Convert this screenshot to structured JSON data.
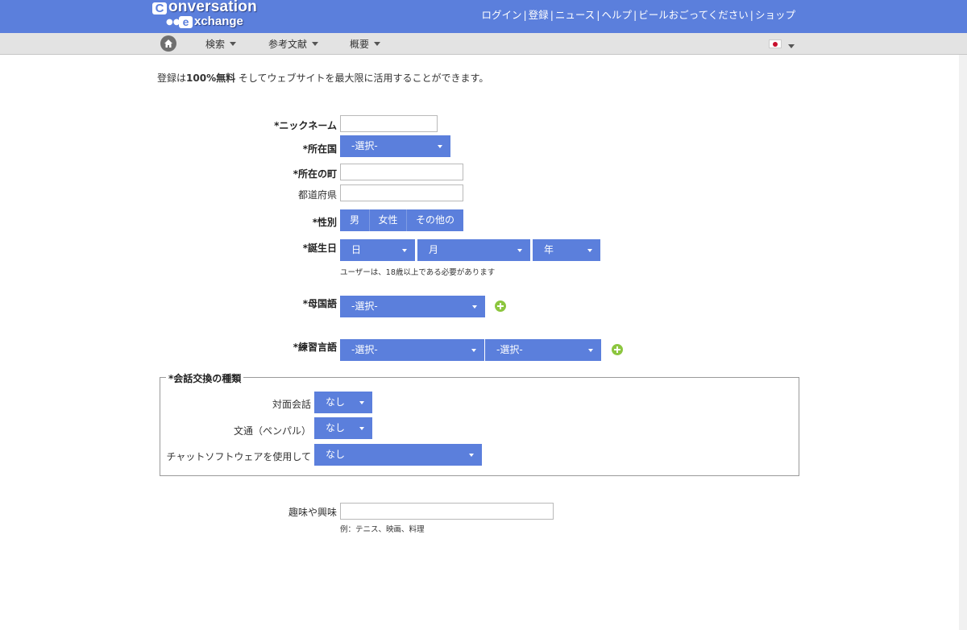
{
  "logo": {
    "letter_c": "C",
    "word1": "onversation",
    "letter_e": "e",
    "word2": "xchange"
  },
  "topnav": [
    "ログイン",
    "登録",
    "ニュース",
    "ヘルプ",
    "ビールおごってください",
    "ショップ"
  ],
  "topnav_separator": "|",
  "subnav": {
    "search": "検索",
    "references": "参考文献",
    "overview": "概要"
  },
  "intro": {
    "prefix": "登録は",
    "bold": "100%無料",
    "suffix": " そしてウェブサイトを最大限に活用することができます。"
  },
  "form": {
    "nickname_label": "*ニックネーム",
    "nickname_value": "",
    "country_label": "*所在国",
    "country_value": "-選択-",
    "town_label": "*所在の町",
    "town_value": "",
    "prefecture_label": "都道府県",
    "prefecture_value": "",
    "gender_label": "*性別",
    "gender_options": [
      "男",
      "女性",
      "その他の"
    ],
    "birthday_label": "*誕生日",
    "birthday_day": "日",
    "birthday_month": "月",
    "birthday_year": "年",
    "age_notice": "ユーザーは、18歳以上である必要があります",
    "native_label": "*母国語",
    "native_value": "-選択-",
    "practice_label": "*練習言語",
    "practice_value_1": "-選択-",
    "practice_value_2": "-選択-",
    "exchange_legend": "*会話交換の種類",
    "face_label": "対面会話",
    "face_value": "なし",
    "penpal_label": "文通（ペンパル）",
    "penpal_value": "なし",
    "chat_label": "チャットソフトウェアを使用して",
    "chat_value": "なし",
    "hobbies_label": "趣味や興味",
    "hobbies_value": "",
    "hobbies_hint": "例：テニス、映画、料理"
  },
  "colors": {
    "header": "#5b7fdc",
    "select": "#5b7fdc",
    "subbar": "#e3e3e3",
    "plus": "#8cc63f"
  },
  "icons": {
    "home": "home-icon",
    "flag": "japan-flag-icon",
    "add": "plus-circle-icon"
  }
}
